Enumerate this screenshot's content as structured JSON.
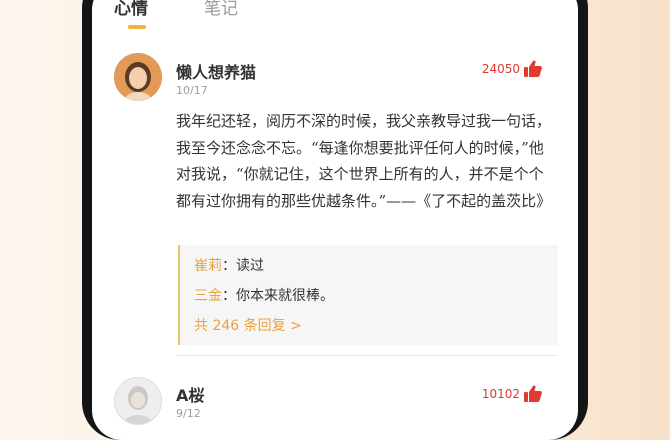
{
  "tabs": {
    "mood": "心情",
    "notes": "笔记"
  },
  "posts": [
    {
      "author": "懒人想养猫",
      "date": "10/17",
      "likes": "24050",
      "avatar_icon": "woman-portrait",
      "content": "我年纪还轻，阅历不深的时候，我父亲教导过我一句话，我至今还念念不忘。“每逢你想要批评任何人的时候，”他对我说，“你就记住，这个世界上所有的人，并不是个个都有过你拥有的那些优越条件。”——《了不起的盖茨比》",
      "replies": [
        {
          "name": "崔莉",
          "text": "读过"
        },
        {
          "name": "三金",
          "text": "你本来就很棒。"
        }
      ],
      "more_replies": "共 246 条回复 >"
    },
    {
      "author": "A桜",
      "date": "9/12",
      "likes": "10102",
      "avatar_icon": "person-portrait"
    }
  ],
  "colors": {
    "accent": "#f3b33a",
    "like": "#e3392e",
    "reply_name": "#e8a33d"
  }
}
